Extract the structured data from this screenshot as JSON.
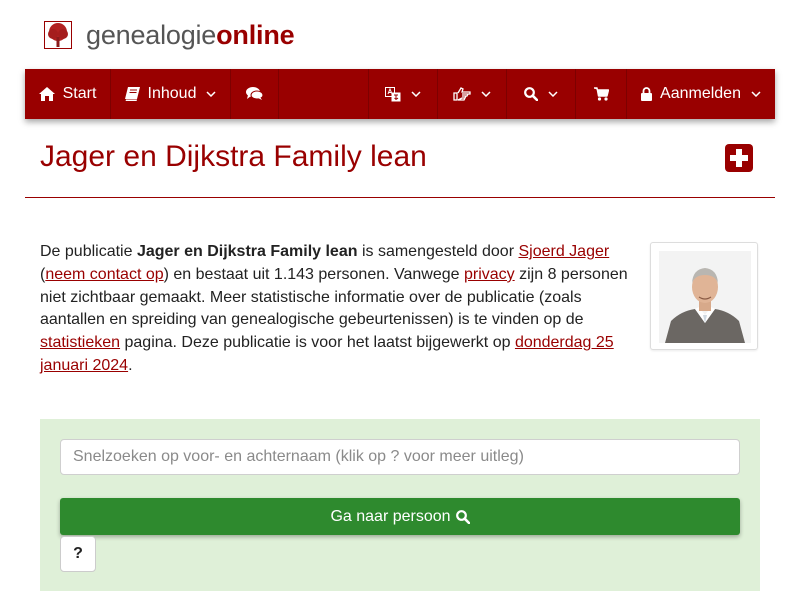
{
  "logo": {
    "text_regular": "genealogie",
    "text_bold": "online"
  },
  "nav": {
    "start": "Start",
    "inhoud": "Inhoud",
    "aanmelden": "Aanmelden"
  },
  "page": {
    "title": "Jager en Dijkstra Family lean"
  },
  "intro": {
    "p1": "De publicatie ",
    "pub_name": "Jager en Dijkstra Family lean",
    "p2": " is samengesteld door ",
    "author_link": "Sjoerd Jager",
    "p3": " (",
    "contact_link": "neem contact op",
    "p4": ") en bestaat uit 1.143 personen. Vanwege ",
    "privacy_link": "privacy",
    "p5": " zijn 8 personen niet zichtbaar gemaakt. Meer statistische informatie over de publicatie (zoals aantallen en spreiding van genealogische gebeurtenissen) is te vinden op de ",
    "stats_link": "statistieken",
    "p6": " pagina. Deze publicatie is voor het laatst bijgewerkt op ",
    "date_link": "donderdag 25 januari 2024",
    "p7": "."
  },
  "search": {
    "placeholder": "Snelzoeken op voor- en achternaam (klik op ? voor meer uitleg)",
    "value": "",
    "go_label": "Ga naar persoon",
    "help_label": "?"
  },
  "icons": {
    "logo": "tree-icon",
    "start": "home-icon",
    "inhoud": "book-icon",
    "forum": "comments-icon",
    "language": "language-icon",
    "share": "share-icon",
    "search": "search-icon",
    "cart": "shopping-cart-icon",
    "login": "lock-icon",
    "add": "plus-square-icon",
    "dropdown": "chevron-down-icon"
  },
  "colors": {
    "brand": "#990000",
    "nav_bg": "#990000",
    "panel_bg": "#dff0d8",
    "button_green": "#2e8a2e",
    "text": "#222222"
  }
}
